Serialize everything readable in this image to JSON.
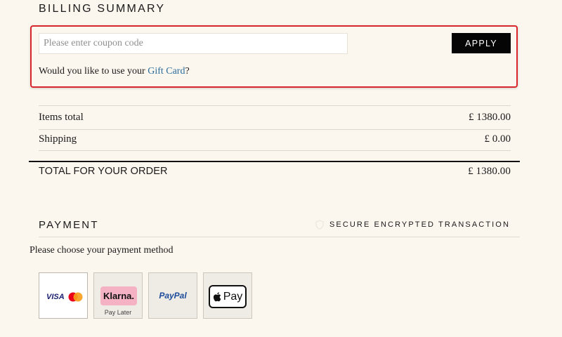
{
  "billing": {
    "title": "BILLING SUMMARY",
    "coupon_placeholder": "Please enter coupon code",
    "apply_label": "APPLY",
    "gift_prefix": "Would you like to use your ",
    "gift_link": "Gift Card",
    "gift_suffix": "?"
  },
  "summary": {
    "items_total_label": "Items total",
    "items_total_value": "£ 1380.00",
    "shipping_label": "Shipping",
    "shipping_value": "£ 0.00",
    "total_label": "TOTAL FOR YOUR ORDER",
    "total_value": "£ 1380.00"
  },
  "payment": {
    "title": "PAYMENT",
    "secure_text": "SECURE ENCRYPTED TRANSACTION",
    "choose_text": "Please choose your payment method",
    "methods": [
      {
        "label": "VISA",
        "name": "visa-mastercard"
      },
      {
        "label": "Klarna.",
        "sub": "Pay Later",
        "name": "klarna"
      },
      {
        "label": "PayPal",
        "name": "paypal"
      },
      {
        "label": "Pay",
        "name": "apple-pay"
      }
    ]
  },
  "colors": {
    "background": "#fbf6ee",
    "highlight_border": "#d8262d",
    "link": "#2a6d9b",
    "apply_button": "#050505"
  }
}
